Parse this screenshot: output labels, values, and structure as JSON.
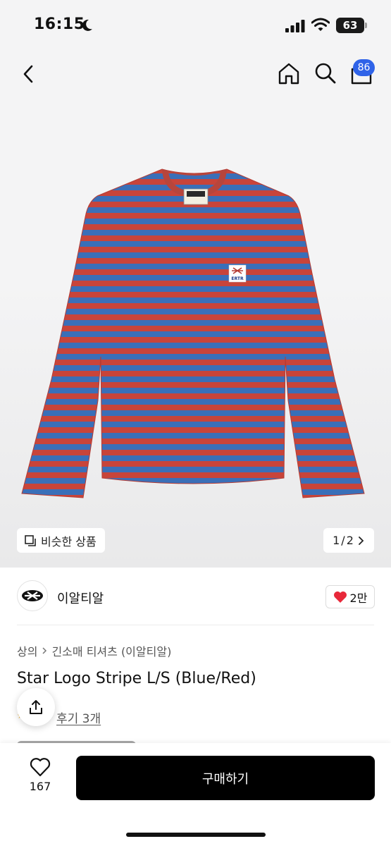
{
  "status_bar": {
    "time": "16:15",
    "battery": "63"
  },
  "header": {
    "cart_count": "86"
  },
  "gallery": {
    "similar_label": "비슷한 상품",
    "current_page": "1",
    "total_pages": "2",
    "page_separator": " / ",
    "shirt_logo_text": "ERTR",
    "stripe_colors": {
      "blue": "#3a6fb8",
      "red": "#c8443a"
    }
  },
  "brand": {
    "name": "이알티알",
    "like_count": "2만",
    "heart_color": "#e8283a"
  },
  "product": {
    "breadcrumb": [
      "상의",
      "긴소매 티셔츠 (이알티알)"
    ],
    "title": "Star Logo Stripe L/S (Blue/Red)",
    "reviews_label": "후기 3개"
  },
  "bottom_bar": {
    "wish_count": "167",
    "buy_label": "구매하기"
  },
  "colors": {
    "badge": "#2f63e8",
    "buy_button": "#000000"
  }
}
